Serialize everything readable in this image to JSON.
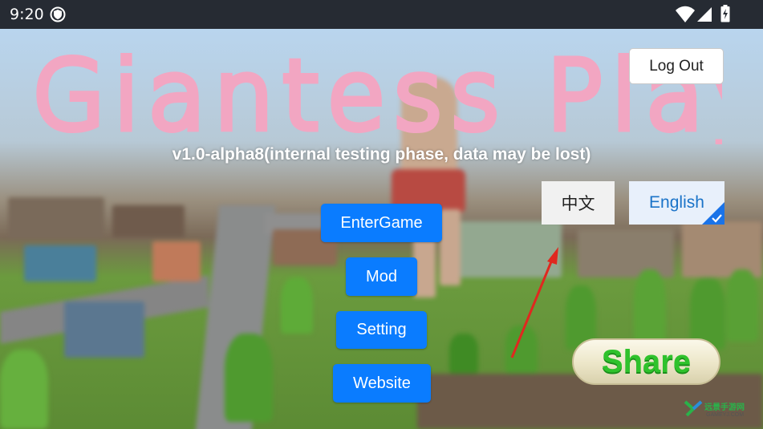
{
  "status_bar": {
    "time": "9:20",
    "app_icon": "shield-icon",
    "wifi_icon": "wifi-icon",
    "signal_icon": "cell-signal-icon",
    "battery_icon": "battery-charging-icon"
  },
  "game": {
    "title": "Giantess Play",
    "version": "v1.0-alpha8(internal testing phase, data may be lost)",
    "logout_label": "Log Out",
    "languages": [
      {
        "label": "中文",
        "selected": false
      },
      {
        "label": "English",
        "selected": true
      }
    ],
    "menu": {
      "enter_game": "EnterGame",
      "mod": "Mod",
      "setting": "Setting",
      "website": "Website"
    },
    "share_label": "Share"
  },
  "watermark": {
    "text": "远景手游网",
    "sub": "GAMEYJ.COM"
  },
  "colors": {
    "primary_button": "#0a7cff",
    "title_pink": "#f2a6c2",
    "share_green": "#2fc22c",
    "status_bar": "#262b33",
    "arrow_red": "#e0281f"
  }
}
